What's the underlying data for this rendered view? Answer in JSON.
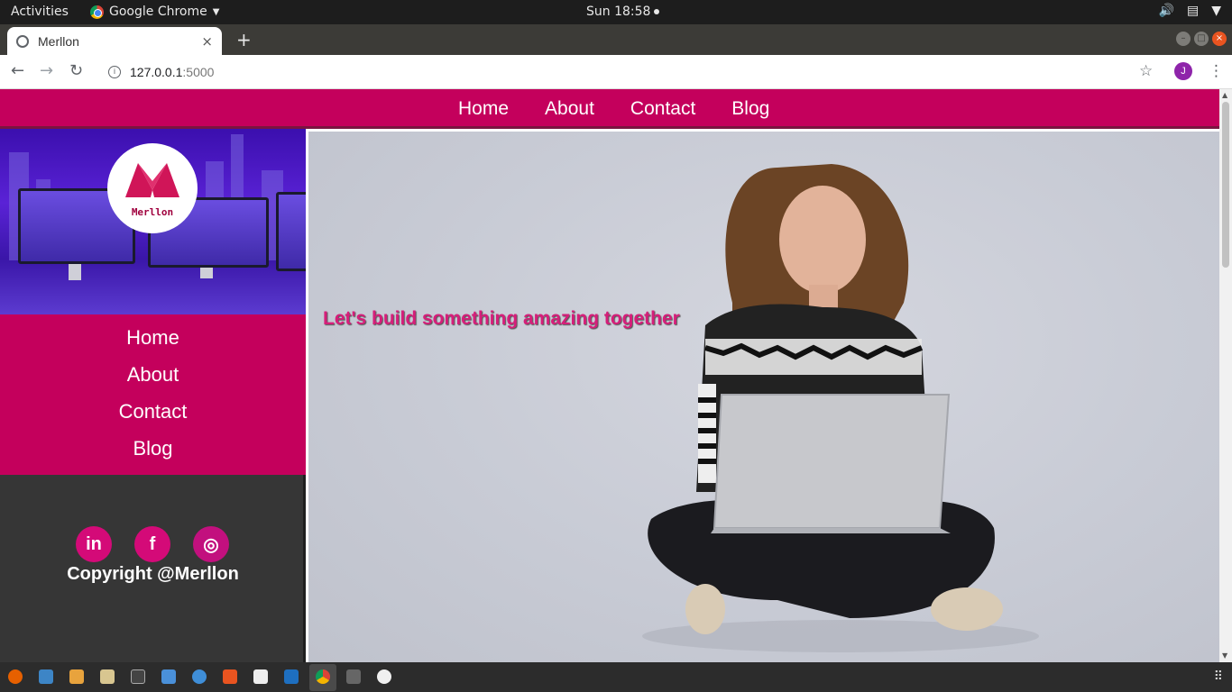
{
  "system": {
    "activities_label": "Activities",
    "app_name": "Google Chrome",
    "clock": "Sun 18:58"
  },
  "browser": {
    "tab_title": "Merllon",
    "tab_close": "×",
    "new_tab": "+",
    "url_host": "127.0.0.1",
    "url_port": ":5000",
    "profile_initial": "J"
  },
  "site": {
    "top_nav": [
      "Home",
      "About",
      "Contact",
      "Blog"
    ],
    "logo_text": "Merllon",
    "side_nav": [
      "Home",
      "About",
      "Contact",
      "Blog"
    ],
    "social": [
      {
        "name": "linkedin-icon",
        "glyph": "in"
      },
      {
        "name": "facebook-icon",
        "glyph": "f"
      },
      {
        "name": "instagram-icon",
        "glyph": "◎"
      }
    ],
    "copyright": "Copyright @Merllon",
    "tagline": "Let's build something amazing together"
  },
  "colors": {
    "brand": "#c4005c",
    "sidebar_bg": "#363636",
    "tagline": "#d61e7a"
  }
}
